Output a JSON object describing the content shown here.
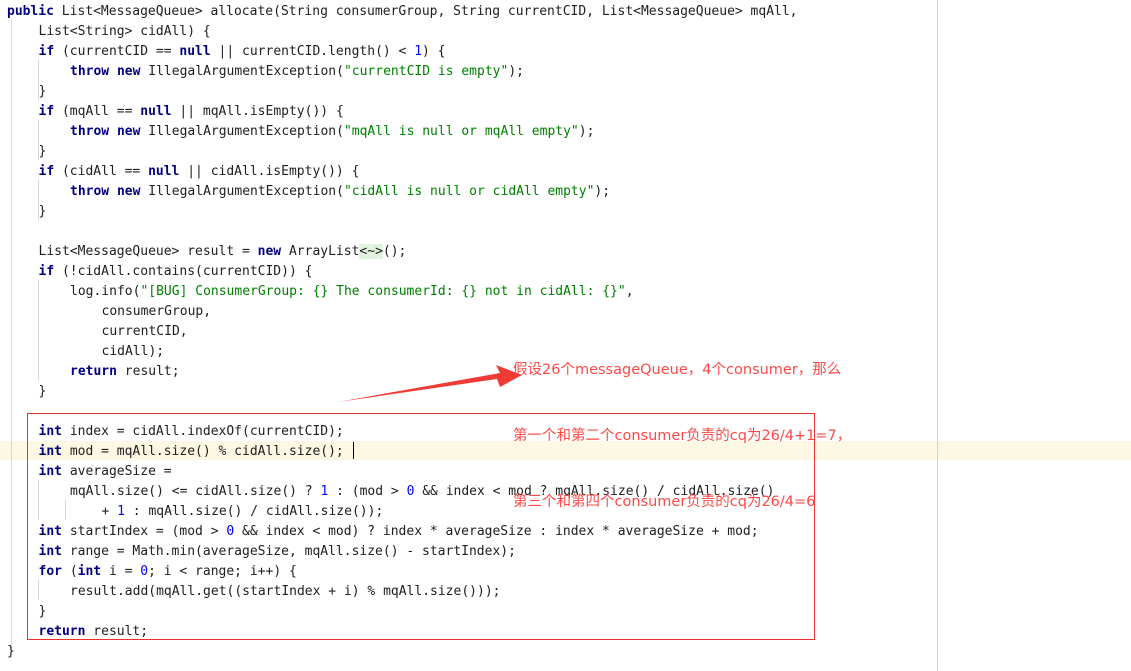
{
  "editor": {
    "theme": "light",
    "background": "#ffffff",
    "keyword_color": "#000080",
    "string_color": "#008000",
    "number_color": "#0000ff",
    "plain_color": "#202020",
    "current_line_highlight_color": "#fdf8e3",
    "indent_guide_color": "#d8d8d8",
    "margin_guide_color": "#d4d4d4",
    "annotation_color": "#fb4a46",
    "box_border_color": "#e8342a"
  },
  "code": {
    "language": "java",
    "lines": [
      {
        "indent": 0,
        "tokens": [
          {
            "t": "public ",
            "c": "kw"
          },
          {
            "t": "List<MessageQueue> allocate(String consumerGroup, String currentCID, List<MessageQueue> mqAll,",
            "c": "plain"
          }
        ]
      },
      {
        "indent": 1,
        "tokens": [
          {
            "t": "List<String> cidAll) {",
            "c": "plain"
          }
        ]
      },
      {
        "indent": 1,
        "tokens": [
          {
            "t": "if ",
            "c": "kw"
          },
          {
            "t": "(currentCID == ",
            "c": "plain"
          },
          {
            "t": "null",
            "c": "kw"
          },
          {
            "t": " || currentCID.length() < ",
            "c": "plain"
          },
          {
            "t": "1",
            "c": "num"
          },
          {
            "t": ") {",
            "c": "plain"
          }
        ]
      },
      {
        "indent": 2,
        "tokens": [
          {
            "t": "throw new ",
            "c": "kw"
          },
          {
            "t": "IllegalArgumentException(",
            "c": "plain"
          },
          {
            "t": "\"currentCID is empty\"",
            "c": "str"
          },
          {
            "t": ");",
            "c": "plain"
          }
        ]
      },
      {
        "indent": 1,
        "tokens": [
          {
            "t": "}",
            "c": "plain"
          }
        ]
      },
      {
        "indent": 1,
        "tokens": [
          {
            "t": "if ",
            "c": "kw"
          },
          {
            "t": "(mqAll == ",
            "c": "plain"
          },
          {
            "t": "null",
            "c": "kw"
          },
          {
            "t": " || mqAll.isEmpty()) {",
            "c": "plain"
          }
        ]
      },
      {
        "indent": 2,
        "tokens": [
          {
            "t": "throw new ",
            "c": "kw"
          },
          {
            "t": "IllegalArgumentException(",
            "c": "plain"
          },
          {
            "t": "\"mqAll is null or mqAll empty\"",
            "c": "str"
          },
          {
            "t": ");",
            "c": "plain"
          }
        ]
      },
      {
        "indent": 1,
        "tokens": [
          {
            "t": "}",
            "c": "plain"
          }
        ]
      },
      {
        "indent": 1,
        "tokens": [
          {
            "t": "if ",
            "c": "kw"
          },
          {
            "t": "(cidAll == ",
            "c": "plain"
          },
          {
            "t": "null",
            "c": "kw"
          },
          {
            "t": " || cidAll.isEmpty()) {",
            "c": "plain"
          }
        ]
      },
      {
        "indent": 2,
        "tokens": [
          {
            "t": "throw new ",
            "c": "kw"
          },
          {
            "t": "IllegalArgumentException(",
            "c": "plain"
          },
          {
            "t": "\"cidAll is null or cidAll empty\"",
            "c": "str"
          },
          {
            "t": ");",
            "c": "plain"
          }
        ]
      },
      {
        "indent": 1,
        "tokens": [
          {
            "t": "}",
            "c": "plain"
          }
        ]
      },
      {
        "indent": 0,
        "tokens": []
      },
      {
        "indent": 1,
        "tokens": [
          {
            "t": "List<MessageQueue> result = ",
            "c": "plain"
          },
          {
            "t": "new ",
            "c": "kw"
          },
          {
            "t": "ArrayList",
            "c": "plain"
          },
          {
            "t": "<~>",
            "c": "diamond"
          },
          {
            "t": "();",
            "c": "plain"
          }
        ]
      },
      {
        "indent": 1,
        "tokens": [
          {
            "t": "if ",
            "c": "kw"
          },
          {
            "t": "(!cidAll.contains(currentCID)) {",
            "c": "plain"
          }
        ]
      },
      {
        "indent": 2,
        "tokens": [
          {
            "t": "log.info(",
            "c": "plain"
          },
          {
            "t": "\"[BUG] ConsumerGroup: {} The consumerId: {} not in cidAll: {}\"",
            "c": "str"
          },
          {
            "t": ",",
            "c": "plain"
          }
        ]
      },
      {
        "indent": 3,
        "tokens": [
          {
            "t": "consumerGroup,",
            "c": "plain"
          }
        ]
      },
      {
        "indent": 3,
        "tokens": [
          {
            "t": "currentCID,",
            "c": "plain"
          }
        ]
      },
      {
        "indent": 3,
        "tokens": [
          {
            "t": "cidAll);",
            "c": "plain"
          }
        ]
      },
      {
        "indent": 2,
        "tokens": [
          {
            "t": "return ",
            "c": "kw"
          },
          {
            "t": "result;",
            "c": "plain"
          }
        ]
      },
      {
        "indent": 1,
        "tokens": [
          {
            "t": "}",
            "c": "plain"
          }
        ]
      },
      {
        "indent": 0,
        "tokens": []
      },
      {
        "indent": 1,
        "tokens": [
          {
            "t": "int ",
            "c": "kw"
          },
          {
            "t": "index = cidAll.indexOf(currentCID);",
            "c": "plain"
          }
        ]
      },
      {
        "indent": 1,
        "tokens": [
          {
            "t": "int ",
            "c": "kw"
          },
          {
            "t": "mod = mqAll.size() % cidAll.size();",
            "c": "plain"
          }
        ]
      },
      {
        "indent": 1,
        "tokens": [
          {
            "t": "int ",
            "c": "kw"
          },
          {
            "t": "averageSize =",
            "c": "plain"
          }
        ]
      },
      {
        "indent": 2,
        "tokens": [
          {
            "t": "mqAll.size() <= cidAll.size() ? ",
            "c": "plain"
          },
          {
            "t": "1",
            "c": "num"
          },
          {
            "t": " : (mod > ",
            "c": "plain"
          },
          {
            "t": "0",
            "c": "num"
          },
          {
            "t": " && index < mod ? mqAll.size() / cidAll.size()",
            "c": "plain"
          }
        ]
      },
      {
        "indent": 3,
        "tokens": [
          {
            "t": "+ ",
            "c": "plain"
          },
          {
            "t": "1",
            "c": "num"
          },
          {
            "t": " : mqAll.size() / cidAll.size());",
            "c": "plain"
          }
        ]
      },
      {
        "indent": 1,
        "tokens": [
          {
            "t": "int ",
            "c": "kw"
          },
          {
            "t": "startIndex = (mod > ",
            "c": "plain"
          },
          {
            "t": "0",
            "c": "num"
          },
          {
            "t": " && index < mod) ? index * averageSize : index * averageSize + mod;",
            "c": "plain"
          }
        ]
      },
      {
        "indent": 1,
        "tokens": [
          {
            "t": "int ",
            "c": "kw"
          },
          {
            "t": "range = Math.min(averageSize, mqAll.size() - startIndex);",
            "c": "plain"
          }
        ]
      },
      {
        "indent": 1,
        "tokens": [
          {
            "t": "for ",
            "c": "kw"
          },
          {
            "t": "(",
            "c": "plain"
          },
          {
            "t": "int ",
            "c": "kw"
          },
          {
            "t": "i = ",
            "c": "plain"
          },
          {
            "t": "0",
            "c": "num"
          },
          {
            "t": "; i < range; i++) {",
            "c": "plain"
          }
        ]
      },
      {
        "indent": 2,
        "tokens": [
          {
            "t": "result.add(mqAll.get((startIndex + i) % mqAll.size()));",
            "c": "plain"
          }
        ]
      },
      {
        "indent": 1,
        "tokens": [
          {
            "t": "}",
            "c": "plain"
          }
        ]
      },
      {
        "indent": 1,
        "tokens": [
          {
            "t": "return ",
            "c": "kw"
          },
          {
            "t": "result;",
            "c": "plain"
          }
        ]
      },
      {
        "indent": 0,
        "tokens": [
          {
            "t": "}",
            "c": "plain"
          }
        ]
      }
    ]
  },
  "annotation": {
    "lines": [
      "假设26个messageQueue，4个consumer，那么",
      "第一个和第二个consumer负责的cq为26/4+1=7，",
      "第三个和第四个consumer负责的cq为26/4=6"
    ],
    "color": "#fb4a46",
    "arrow": "arrow-pointing-up-right",
    "box_label": "highlighted-code-region"
  }
}
